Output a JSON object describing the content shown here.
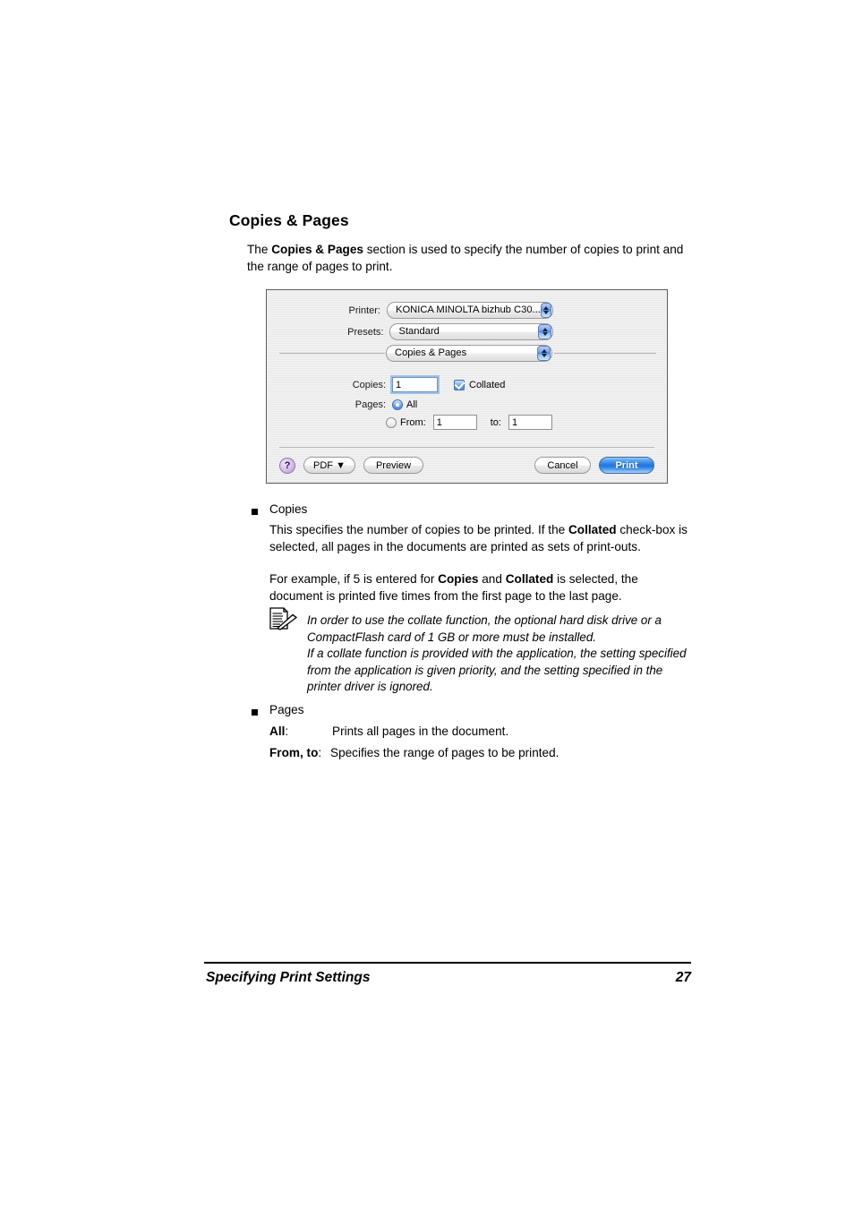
{
  "section": {
    "heading": "Copies & Pages",
    "intro_prefix": "The ",
    "intro_bold": "Copies & Pages",
    "intro_suffix": " section is used to specify the number of copies to print and the range of pages to print."
  },
  "dialog": {
    "printer_label": "Printer:",
    "printer_value": "KONICA MINOLTA bizhub C30...",
    "presets_label": "Presets:",
    "presets_value": "Standard",
    "pane_value": "Copies & Pages",
    "copies_label": "Copies:",
    "copies_value": "1",
    "collated_label": "Collated",
    "collated_checked": true,
    "pages_label": "Pages:",
    "all_label": "All",
    "all_selected": true,
    "from_label": "From:",
    "from_value": "1",
    "to_label": "to:",
    "to_value": "1",
    "help_label": "?",
    "pdf_label": "PDF ▼",
    "preview_label": "Preview",
    "cancel_label": "Cancel",
    "print_label": "Print",
    "accent_color": "#1d74e0",
    "help_color": "#c9a8e4",
    "arrow_color": "#4f86dd"
  },
  "bullets": {
    "copies": {
      "title": "Copies",
      "line1_a": "This specifies the number of copies to be printed. If the ",
      "line1_b": "Collated",
      "line1_c": " check-box is selected, all pages in the documents are printed as sets of print-outs.",
      "line2_a": "For example, if 5 is entered for ",
      "line2_b": "Copies",
      "line2_c": " and ",
      "line2_d": "Collated",
      "line2_e": " is selected, the document is printed five times from the first page to the last page."
    },
    "note": {
      "icon": "note-memo-icon",
      "para1": "In order to use the collate function, the optional hard disk drive or a CompactFlash card of 1 GB or more must be installed.",
      "para2": "If a collate function is provided with the application, the setting specified from the application is given priority, and the setting specified in the printer driver is ignored."
    },
    "pages": {
      "title": "Pages",
      "all_term": "All",
      "all_colon": ":",
      "all_desc": "Prints all pages in the document.",
      "fromto_term": "From, to",
      "fromto_colon": ":",
      "fromto_desc": "Specifies the range of pages to be printed."
    }
  },
  "footer": {
    "title": "Specifying Print Settings",
    "page_number": "27"
  }
}
